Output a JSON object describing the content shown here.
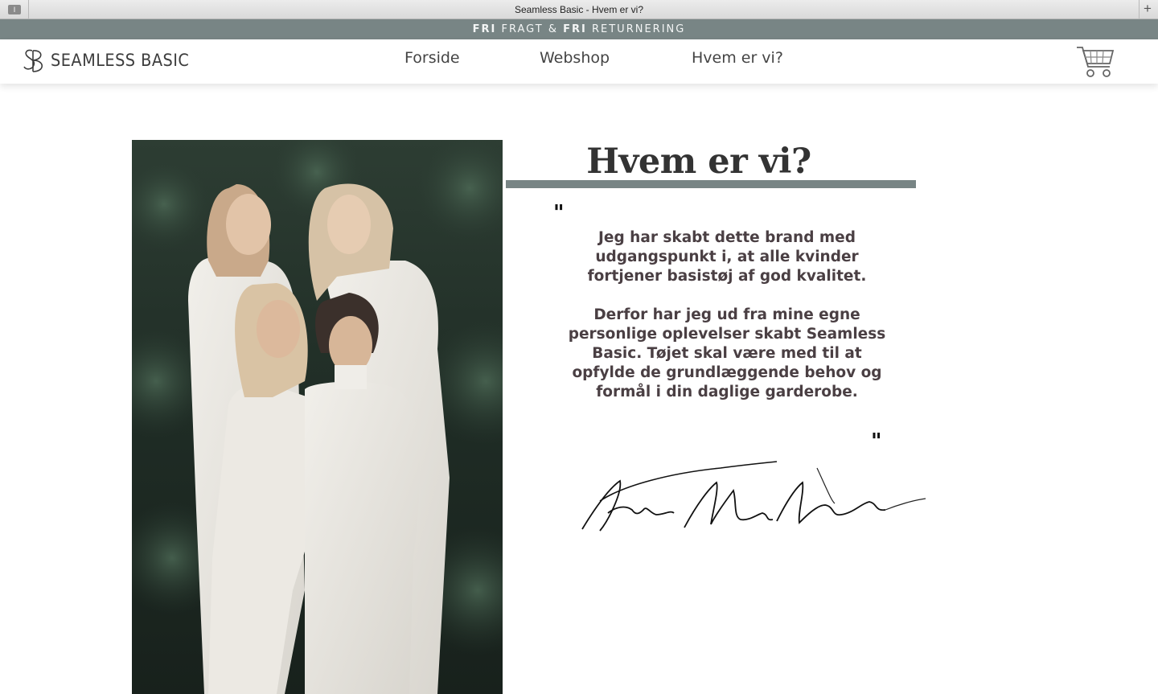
{
  "browser": {
    "window_title": "Seamless Basic - Hvem er vi?"
  },
  "promo": {
    "word1": "FRI",
    "text1": " FRAGT & ",
    "word2": "FRI",
    "text2": " RETURNERING"
  },
  "header": {
    "logo_text": "SEAMLESS BASIC",
    "nav": [
      "Forside",
      "Webshop",
      "Hvem er vi?"
    ],
    "cart_icon": "shopping-cart-icon"
  },
  "content": {
    "heading": "Hvem er vi?",
    "quote_open": "\"",
    "quote_close": "\"",
    "paragraph1": "Jeg har skabt dette brand med udgangspunkt i, at alle kvinder fortjener basistøj af god kvalitet.",
    "paragraph2": "Derfor har jeg ud fra mine egne personlige oplevelser skabt Seamless Basic. Tøjet skal være med til at opfylde de grundlæggende behov og formål i din daglige garderobe.",
    "signature": "Trine Weber Larsen"
  },
  "colors": {
    "accent": "#788585",
    "text": "#4a3f43"
  }
}
